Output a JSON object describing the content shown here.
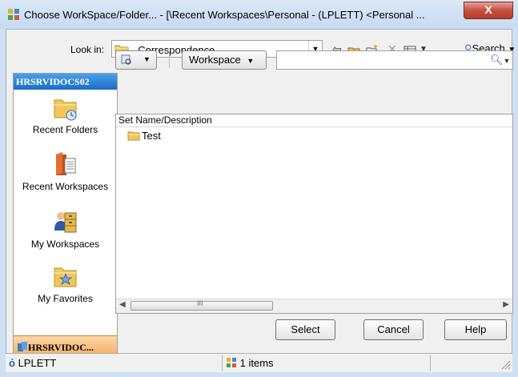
{
  "window": {
    "title": "Choose WorkSpace/Folder... - [\\Recent Workspaces\\Personal - (LPLETT) <Personal ...",
    "close_label": "X"
  },
  "toolbar": {
    "lookin_label": "Look in:",
    "lookin_value": "_Correspondence",
    "search_label": "Search"
  },
  "sidebar": {
    "header": "HRSRVIDOCS02",
    "items": [
      {
        "label": "Recent Folders",
        "icon": "recent-folders-icon"
      },
      {
        "label": "Recent Workspaces",
        "icon": "recent-workspaces-icon"
      },
      {
        "label": "My Workspaces",
        "icon": "my-workspaces-icon"
      },
      {
        "label": "My Favorites",
        "icon": "my-favorites-icon"
      }
    ],
    "footer": "HRSRVIDOC..."
  },
  "filter": {
    "scope_label": "Workspace",
    "search_value": "",
    "search_placeholder": ""
  },
  "list": {
    "column_header": "Set Name/Description",
    "rows": [
      {
        "label": "Test",
        "icon": "folder-icon"
      }
    ]
  },
  "buttons": {
    "select": "Select",
    "cancel": "Cancel",
    "help": "Help"
  },
  "status": {
    "user": "LPLETT",
    "count": "1 items"
  },
  "colors": {
    "nav_header": "#1a6cc8",
    "nav_footer": "#f5a85a",
    "close_button": "#c7503f",
    "folder": "#f2c75a"
  }
}
